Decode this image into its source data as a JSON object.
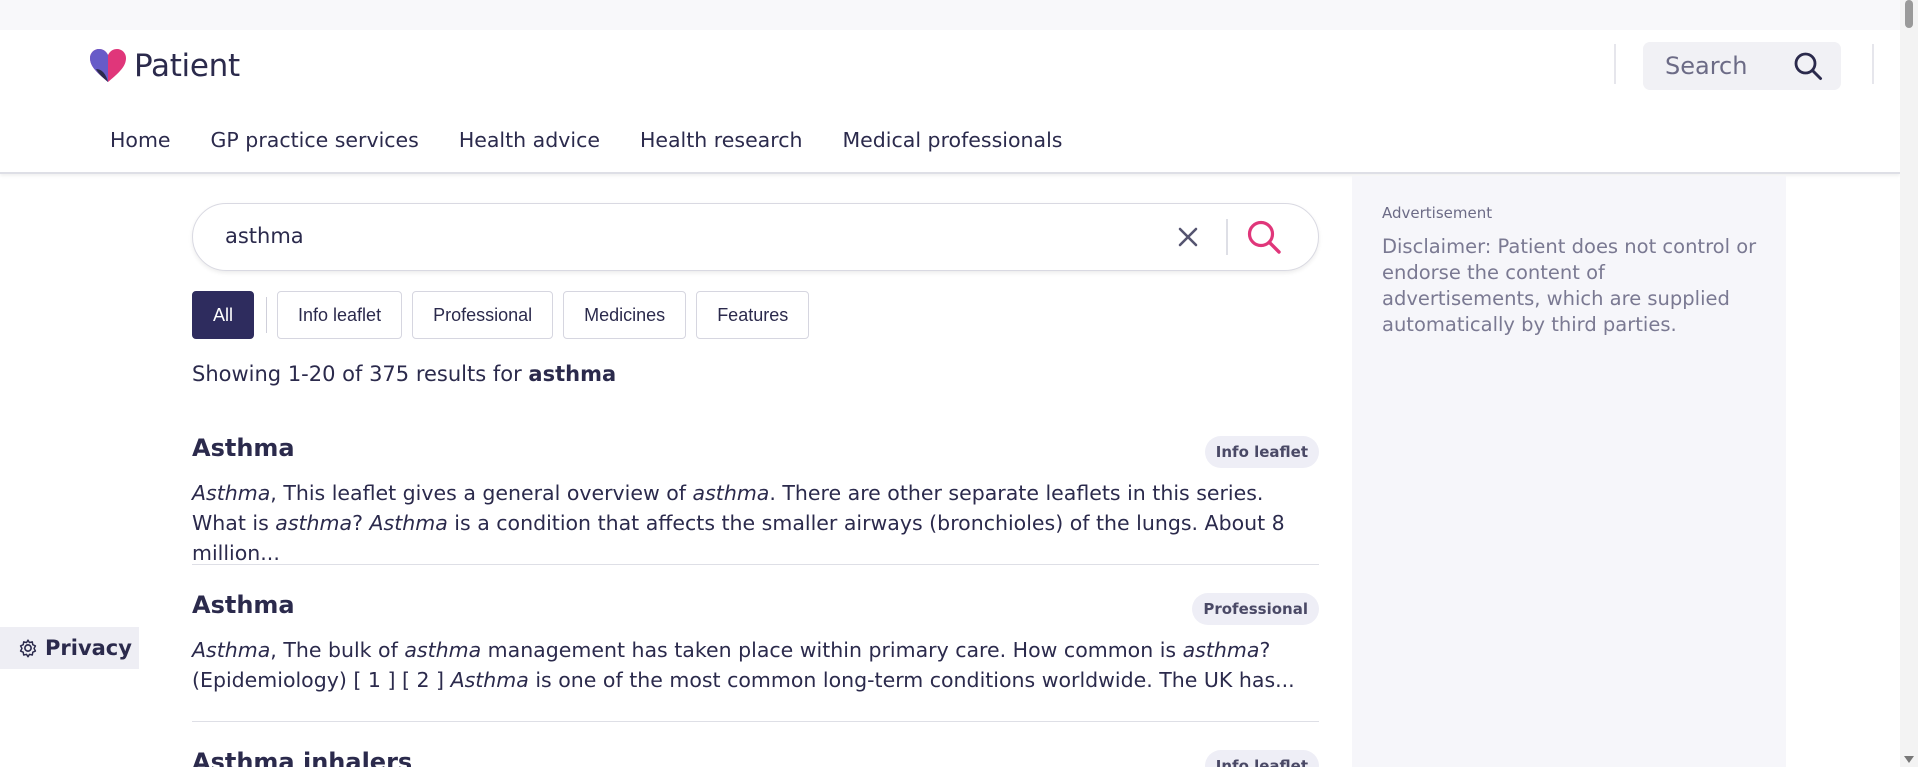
{
  "header": {
    "logo_text": "Patient",
    "search_label": "Search",
    "nav": [
      "Home",
      "GP practice services",
      "Health advice",
      "Health research",
      "Medical professionals"
    ]
  },
  "search": {
    "query": "asthma"
  },
  "filters": {
    "items": [
      "All",
      "Info leaflet",
      "Professional",
      "Medicines",
      "Features"
    ],
    "active": "All"
  },
  "summary": {
    "prefix": "Showing 1-20 of 375 results for ",
    "term": "asthma"
  },
  "results": [
    {
      "title": "Asthma",
      "badge": "Info leaflet",
      "snippet": [
        {
          "t": "Asthma",
          "i": true
        },
        {
          "t": ", This leaflet gives a general overview of "
        },
        {
          "t": "asthma",
          "i": true
        },
        {
          "t": ". There are other separate leaflets in this series. What is "
        },
        {
          "t": "asthma",
          "i": true
        },
        {
          "t": "? "
        },
        {
          "t": "Asthma",
          "i": true
        },
        {
          "t": " is a condition that affects the smaller airways (bronchioles) of the lungs. About 8 million..."
        }
      ]
    },
    {
      "title": "Asthma",
      "badge": "Professional",
      "snippet": [
        {
          "t": "Asthma",
          "i": true
        },
        {
          "t": ", The bulk of "
        },
        {
          "t": "asthma",
          "i": true
        },
        {
          "t": " management has taken place within primary care. How common is "
        },
        {
          "t": "asthma",
          "i": true
        },
        {
          "t": "? (Epidemiology) [ 1 ] [ 2 ] "
        },
        {
          "t": "Asthma",
          "i": true
        },
        {
          "t": " is one of the most common long-term conditions worldwide. The UK has..."
        }
      ]
    },
    {
      "title": "Asthma inhalers",
      "badge": "Info leaflet",
      "snippet": []
    }
  ],
  "sidebar": {
    "ad_label": "Advertisement",
    "disclaimer": "Disclaimer: Patient does not control or endorse the content of advertisements, which are supplied automatically by third parties."
  },
  "privacy": {
    "label": "Privacy"
  },
  "colors": {
    "brand_pink": "#e0367a",
    "brand_navy": "#2b2a4c",
    "active_chip": "#2e2c5e"
  }
}
